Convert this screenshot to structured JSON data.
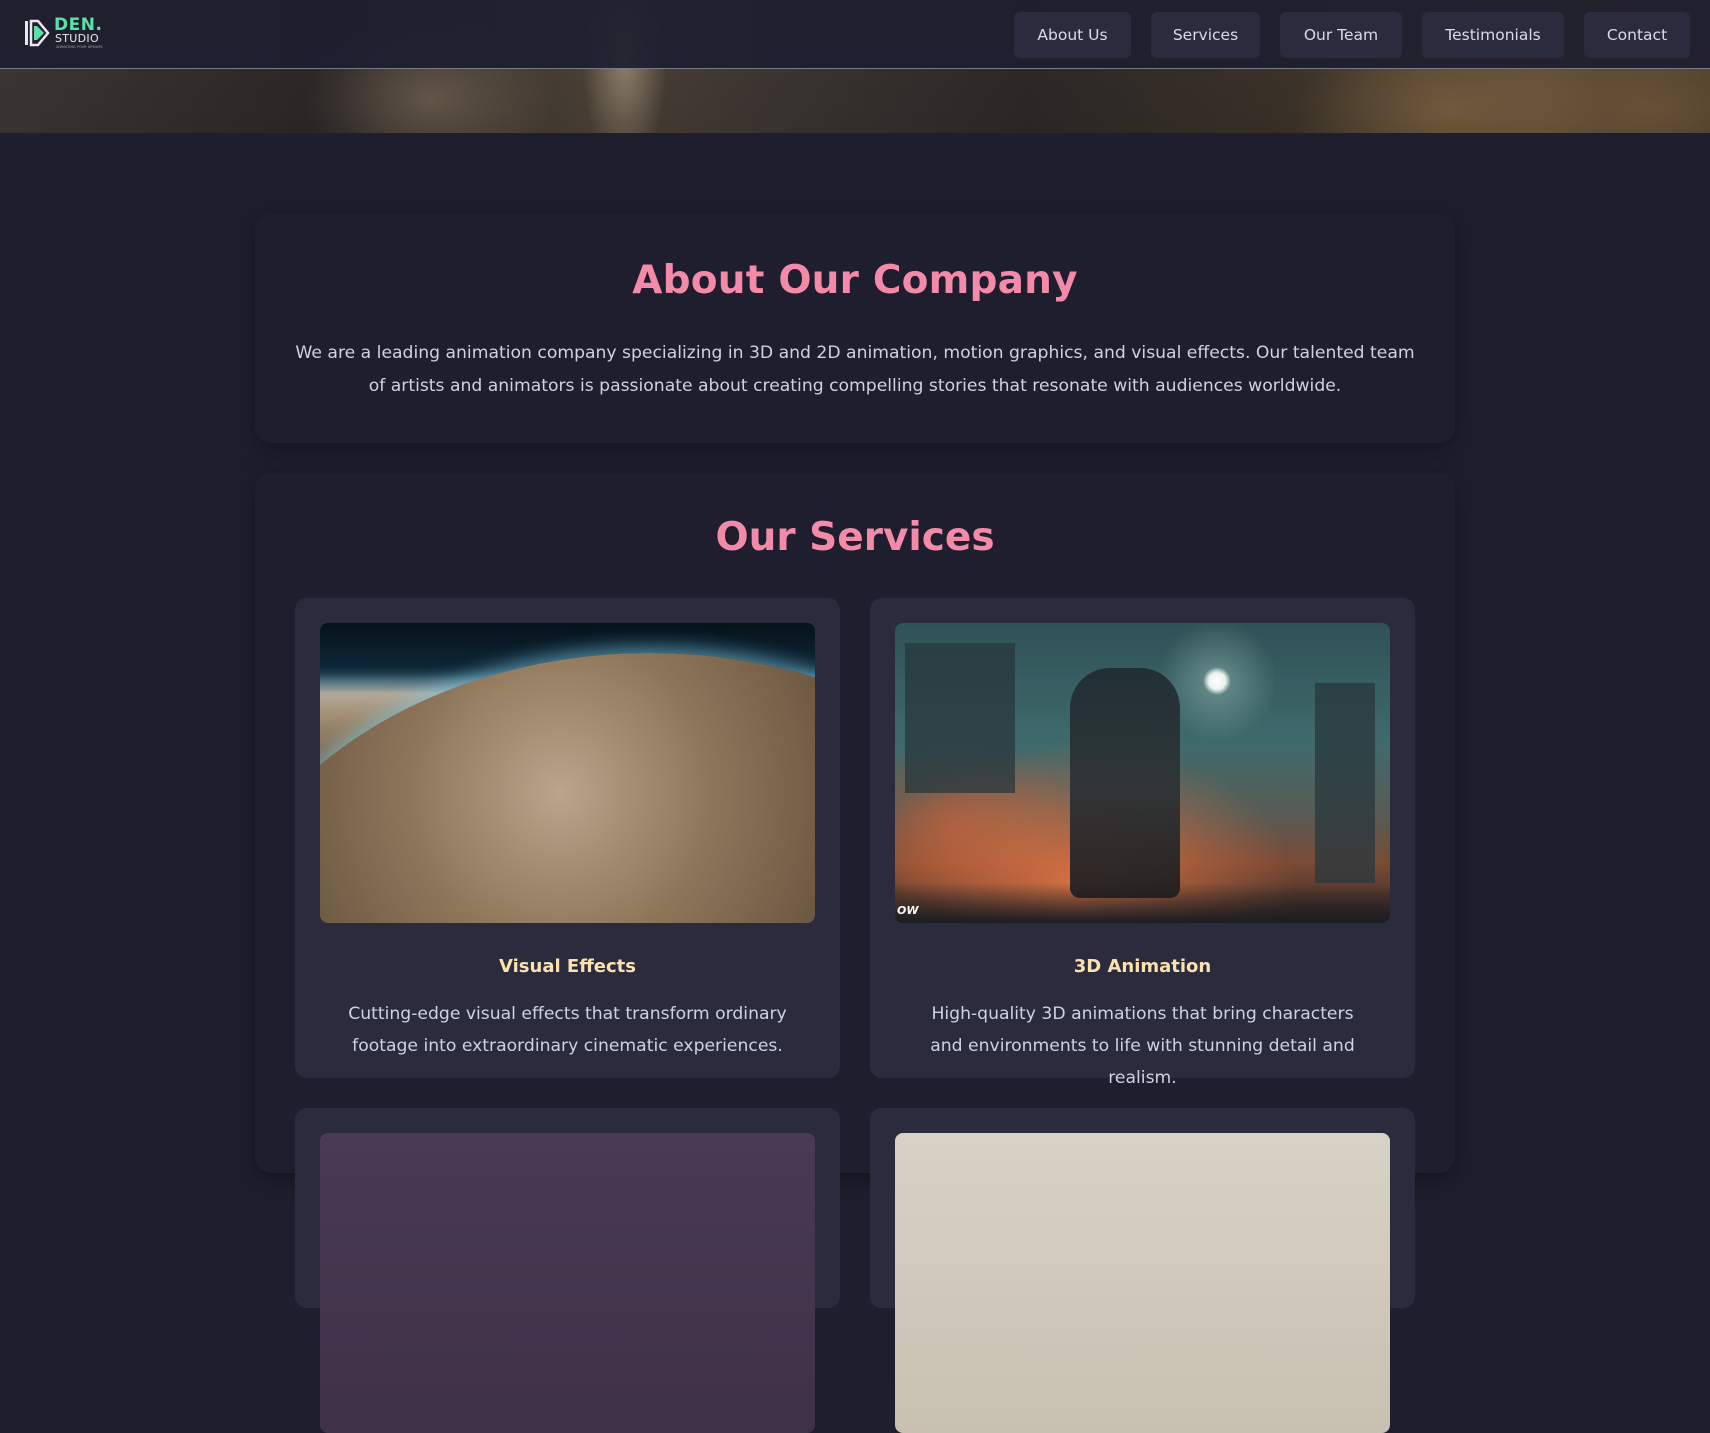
{
  "nav": {
    "logo": {
      "word1": "DEN.",
      "word2": "STUDIO",
      "tagline": "ANIMATING YOUR DREAMS"
    },
    "items": [
      {
        "label": "About Us"
      },
      {
        "label": "Services"
      },
      {
        "label": "Our Team"
      },
      {
        "label": "Testimonials"
      },
      {
        "label": "Contact"
      }
    ]
  },
  "about": {
    "title": "About Our Company",
    "text": "We are a leading animation company specializing in 3D and 2D animation, motion graphics, and visual effects. Our talented team of artists and animators is passionate about creating compelling stories that resonate with audiences worldwide."
  },
  "services": {
    "title": "Our Services",
    "items": [
      {
        "title": "Visual Effects",
        "description": "Cutting-edge visual effects that transform ordinary footage into extraordinary cinematic experiences.",
        "image": "planet-horizon-image"
      },
      {
        "title": "3D Animation",
        "description": "High-quality 3D animations that bring characters and environments to life with stunning detail and realism.",
        "image": "warrior-scene-image",
        "watermark": "OW"
      }
    ]
  },
  "colors": {
    "background": "#1e1e2e",
    "card": "#2a2c3e",
    "heading_pink": "#f38ba8",
    "service_title_yellow": "#f9e2af",
    "logo_green": "#5ce0a8"
  }
}
